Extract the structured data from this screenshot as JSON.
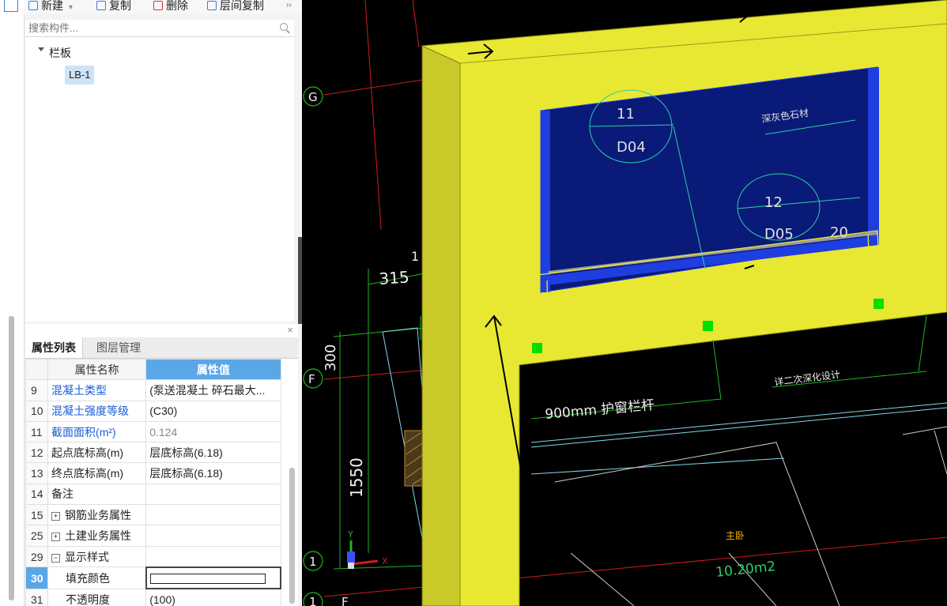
{
  "toolbar": {
    "new_label": "新建",
    "copy_label": "复制",
    "delete_label": "删除",
    "floor_copy_label": "层间复制",
    "more_glyph": "››"
  },
  "search": {
    "placeholder": "搜索构件..."
  },
  "tree": {
    "root_label": "栏板",
    "child_label": "LB-1"
  },
  "props_panel": {
    "close_glyph": "×",
    "tab_properties": "属性列表",
    "tab_layers": "图层管理",
    "header_name": "属性名称",
    "header_value": "属性值",
    "rows": [
      {
        "no": "9",
        "name": "混凝土类型",
        "value": "(泵送混凝土 碎石最大..."
      },
      {
        "no": "10",
        "name": "混凝土强度等级",
        "value": "(C30)"
      },
      {
        "no": "11",
        "name": "截面面积(m²)",
        "value": "0.124"
      },
      {
        "no": "12",
        "name": "起点底标高(m)",
        "value": "层底标高(6.18)"
      },
      {
        "no": "13",
        "name": "终点底标高(m)",
        "value": "层底标高(6.18)"
      },
      {
        "no": "14",
        "name": "备注",
        "value": ""
      },
      {
        "no": "15",
        "name": "钢筋业务属性",
        "value": ""
      },
      {
        "no": "25",
        "name": "土建业务属性",
        "value": ""
      },
      {
        "no": "29",
        "name": "显示样式",
        "value": ""
      },
      {
        "no": "30",
        "name": "填充颜色",
        "value": ""
      },
      {
        "no": "31",
        "name": "不透明度",
        "value": "(100)"
      }
    ],
    "expand_glyph": "+",
    "collapse_glyph": "−"
  },
  "cad": {
    "axis_g": "G",
    "axis_f": "F",
    "axis_1": "1",
    "axis_1b": "1",
    "axis_f2": "F",
    "dim_315": "315",
    "dim_300": "300",
    "dim_1550": "1550",
    "dim_top": "1",
    "circle1_top": "11",
    "circle1_bottom": "D04",
    "circle2_top": "12",
    "circle2_bottom": "D05",
    "label_20": "20",
    "label_stone": "深灰色石材",
    "label_railing": "900mm 护窗栏杆",
    "label_design": "详二次深化设计",
    "label_room": "主卧",
    "label_area": "10.20m2",
    "ucs_x": "X",
    "ucs_y": "Y",
    "colors": {
      "slab": "#e8e832",
      "slab_dark": "#c9c92a",
      "window": "#0a1a78",
      "frame": "#1f3ee0",
      "rail": "#9c9c9c",
      "grid_red": "#d01c1c",
      "dim_green": "#1fb51f",
      "text_white": "#f0f0f0",
      "handle": "#00e000"
    }
  }
}
